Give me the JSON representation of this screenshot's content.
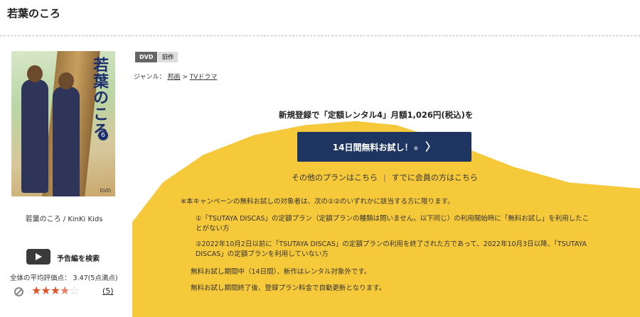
{
  "page_title": "若葉のころ",
  "cover": {
    "title": "若葉のころ",
    "volume": "6",
    "tag": "DVD"
  },
  "caption": "若葉のころ / KinKi Kids",
  "trailer": {
    "label": "予告編を検索",
    "icon": "play-icon"
  },
  "rating": {
    "average_text": "全体の平均評価点：  3.47(5点満点)",
    "stars": 3.5,
    "review_count": "(5)",
    "colors": {
      "filled": "#e0552b",
      "empty": "#cccccc"
    }
  },
  "badges": {
    "dvd": "DVD",
    "old": "旧作"
  },
  "genre": {
    "label": "ジャンル：",
    "cat1": "邦画",
    "sep": ">",
    "cat2": "TVドラマ"
  },
  "promo": {
    "headline": "新規登録で「定額レンタル4」月額1,026円(税込)を",
    "cta_label": "14日間無料お試し！",
    "cta_note": "※",
    "cta_chevron": "〉",
    "other_plans": "その他のプランはこちら",
    "link_sep": "|",
    "member_link": "すでに会員の方はこちら"
  },
  "terms": {
    "intro": "※本キャンペーンの無料お試しの対象者は、次の①②のいずれかに該当する方に限ります。",
    "item1": "①「TSUTAYA DISCAS」の定額プラン（定額プランの種類は問いません。以下同じ）の利用開始時に「無料お試し」を利用したことがない方",
    "item2": "②2022年10月2日以前に「TSUTAYA DISCAS」の定額プランの利用を終了された方であって、2022年10月3日以降、「TSUTAYA DISCAS」の定額プランを利用していない方",
    "note1": "無料お試し期間中（14日間）、新作はレンタル対象外です。",
    "note2": "無料お試し期間終了後、登録プラン料金で自動更新となります。"
  },
  "colors": {
    "cta": "#1e3461",
    "yellow": "#f6c93b"
  }
}
